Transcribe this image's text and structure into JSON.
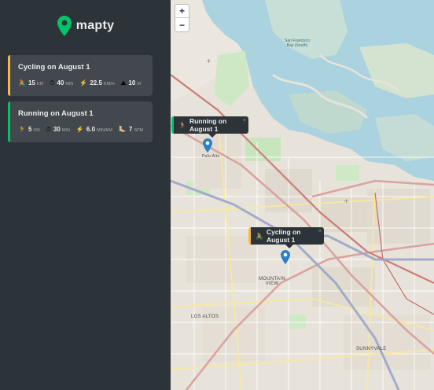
{
  "app": {
    "name": "mapty"
  },
  "workouts": [
    {
      "type": "cycling",
      "title": "Cycling on August 1",
      "details": [
        {
          "icon": "🚴",
          "value": "15",
          "unit": "KM"
        },
        {
          "icon": "⏱",
          "value": "40",
          "unit": "MIN"
        },
        {
          "icon": "⚡️",
          "value": "22.5",
          "unit": "KM/H"
        },
        {
          "icon": "⛰",
          "value": "10",
          "unit": "M"
        }
      ]
    },
    {
      "type": "running",
      "title": "Running on August 1",
      "details": [
        {
          "icon": "🏃",
          "value": "5",
          "unit": "KM"
        },
        {
          "icon": "⏱",
          "value": "30",
          "unit": "MIN"
        },
        {
          "icon": "⚡️",
          "value": "6.0",
          "unit": "MIN/KM"
        },
        {
          "icon": "🦶🏼",
          "value": "7",
          "unit": "SPM"
        }
      ]
    }
  ],
  "map": {
    "zoom_in": "+",
    "zoom_out": "−",
    "popups": {
      "running": {
        "icon": "🏃",
        "text": "Running on August 1",
        "close": "×"
      },
      "cycling": {
        "icon": "🚴",
        "text": "Cycling on August 1",
        "close": "×"
      }
    },
    "labels": {
      "palo_alto": "Palo Alto",
      "mountain_view_1": "MOUNTAIN",
      "mountain_view_2": "VIEW",
      "los_altos": "LOS ALTOS",
      "sunnyvale": "SUNNYVALE",
      "bay_1": "San Francisco",
      "bay_2": "Bay (South)"
    }
  },
  "colors": {
    "sidebar_bg": "#2d3439",
    "card_bg": "#42484d",
    "brand_green": "#00c46a",
    "brand_yellow": "#ffb545",
    "water": "#aad3df",
    "marker": "#2a81cb"
  }
}
